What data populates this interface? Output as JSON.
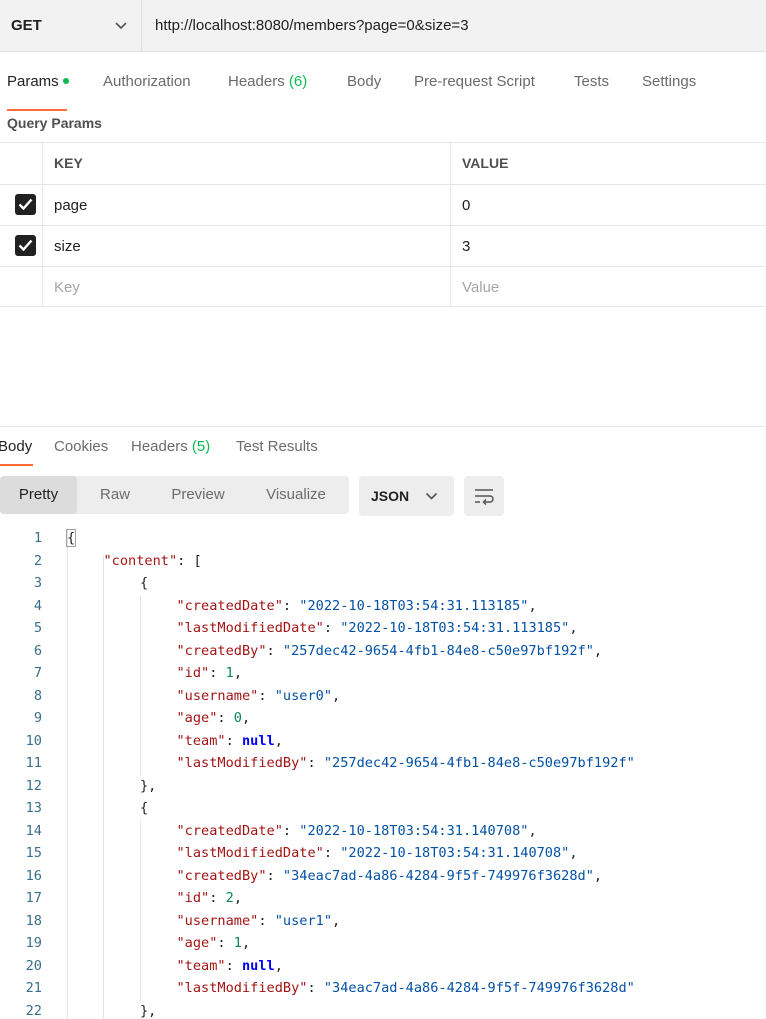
{
  "request": {
    "method": "GET",
    "url": "http://localhost:8080/members?page=0&size=3"
  },
  "request_tabs": [
    {
      "label": "Params",
      "count": null,
      "active": true
    },
    {
      "label": "Authorization",
      "count": null
    },
    {
      "label": "Headers",
      "count": "(6)"
    },
    {
      "label": "Body",
      "count": null
    },
    {
      "label": "Pre-request Script",
      "count": null
    },
    {
      "label": "Tests",
      "count": null
    },
    {
      "label": "Settings",
      "count": null
    }
  ],
  "query_params": {
    "title": "Query Params",
    "header_key": "KEY",
    "header_value": "VALUE",
    "rows": [
      {
        "key": "page",
        "value": "0",
        "checked": true
      },
      {
        "key": "size",
        "value": "3",
        "checked": true
      }
    ],
    "placeholder_key": "Key",
    "placeholder_value": "Value"
  },
  "response_tabs": [
    {
      "label": "Body",
      "count": null,
      "active": true
    },
    {
      "label": "Cookies",
      "count": null
    },
    {
      "label": "Headers",
      "count": "(5)"
    },
    {
      "label": "Test Results",
      "count": null
    }
  ],
  "view_modes": [
    "Pretty",
    "Raw",
    "Preview",
    "Visualize"
  ],
  "active_view": "Pretty",
  "format": "JSON",
  "code_lines": [
    {
      "n": "1",
      "indent": 0,
      "tokens": [
        [
          "p",
          "{"
        ]
      ],
      "hl": true
    },
    {
      "n": "2",
      "indent": 1,
      "tokens": [
        [
          "k",
          "\"content\""
        ],
        [
          "p",
          ": ["
        ]
      ]
    },
    {
      "n": "3",
      "indent": 2,
      "tokens": [
        [
          "p",
          "{"
        ]
      ]
    },
    {
      "n": "4",
      "indent": 3,
      "tokens": [
        [
          "k",
          "\"createdDate\""
        ],
        [
          "p",
          ": "
        ],
        [
          "s",
          "\"2022-10-18T03:54:31.113185\""
        ],
        [
          "p",
          ","
        ]
      ]
    },
    {
      "n": "5",
      "indent": 3,
      "tokens": [
        [
          "k",
          "\"lastModifiedDate\""
        ],
        [
          "p",
          ": "
        ],
        [
          "s",
          "\"2022-10-18T03:54:31.113185\""
        ],
        [
          "p",
          ","
        ]
      ]
    },
    {
      "n": "6",
      "indent": 3,
      "tokens": [
        [
          "k",
          "\"createdBy\""
        ],
        [
          "p",
          ": "
        ],
        [
          "s",
          "\"257dec42-9654-4fb1-84e8-c50e97bf192f\""
        ],
        [
          "p",
          ","
        ]
      ]
    },
    {
      "n": "7",
      "indent": 3,
      "tokens": [
        [
          "k",
          "\"id\""
        ],
        [
          "p",
          ": "
        ],
        [
          "n",
          "1"
        ],
        [
          "p",
          ","
        ]
      ]
    },
    {
      "n": "8",
      "indent": 3,
      "tokens": [
        [
          "k",
          "\"username\""
        ],
        [
          "p",
          ": "
        ],
        [
          "s",
          "\"user0\""
        ],
        [
          "p",
          ","
        ]
      ]
    },
    {
      "n": "9",
      "indent": 3,
      "tokens": [
        [
          "k",
          "\"age\""
        ],
        [
          "p",
          ": "
        ],
        [
          "n",
          "0"
        ],
        [
          "p",
          ","
        ]
      ]
    },
    {
      "n": "10",
      "indent": 3,
      "tokens": [
        [
          "k",
          "\"team\""
        ],
        [
          "p",
          ": "
        ],
        [
          "b",
          "null"
        ],
        [
          "p",
          ","
        ]
      ]
    },
    {
      "n": "11",
      "indent": 3,
      "tokens": [
        [
          "k",
          "\"lastModifiedBy\""
        ],
        [
          "p",
          ": "
        ],
        [
          "s",
          "\"257dec42-9654-4fb1-84e8-c50e97bf192f\""
        ]
      ]
    },
    {
      "n": "12",
      "indent": 2,
      "tokens": [
        [
          "p",
          "},"
        ]
      ]
    },
    {
      "n": "13",
      "indent": 2,
      "tokens": [
        [
          "p",
          "{"
        ]
      ]
    },
    {
      "n": "14",
      "indent": 3,
      "tokens": [
        [
          "k",
          "\"createdDate\""
        ],
        [
          "p",
          ": "
        ],
        [
          "s",
          "\"2022-10-18T03:54:31.140708\""
        ],
        [
          "p",
          ","
        ]
      ]
    },
    {
      "n": "15",
      "indent": 3,
      "tokens": [
        [
          "k",
          "\"lastModifiedDate\""
        ],
        [
          "p",
          ": "
        ],
        [
          "s",
          "\"2022-10-18T03:54:31.140708\""
        ],
        [
          "p",
          ","
        ]
      ]
    },
    {
      "n": "16",
      "indent": 3,
      "tokens": [
        [
          "k",
          "\"createdBy\""
        ],
        [
          "p",
          ": "
        ],
        [
          "s",
          "\"34eac7ad-4a86-4284-9f5f-749976f3628d\""
        ],
        [
          "p",
          ","
        ]
      ]
    },
    {
      "n": "17",
      "indent": 3,
      "tokens": [
        [
          "k",
          "\"id\""
        ],
        [
          "p",
          ": "
        ],
        [
          "n",
          "2"
        ],
        [
          "p",
          ","
        ]
      ]
    },
    {
      "n": "18",
      "indent": 3,
      "tokens": [
        [
          "k",
          "\"username\""
        ],
        [
          "p",
          ": "
        ],
        [
          "s",
          "\"user1\""
        ],
        [
          "p",
          ","
        ]
      ]
    },
    {
      "n": "19",
      "indent": 3,
      "tokens": [
        [
          "k",
          "\"age\""
        ],
        [
          "p",
          ": "
        ],
        [
          "n",
          "1"
        ],
        [
          "p",
          ","
        ]
      ]
    },
    {
      "n": "20",
      "indent": 3,
      "tokens": [
        [
          "k",
          "\"team\""
        ],
        [
          "p",
          ": "
        ],
        [
          "b",
          "null"
        ],
        [
          "p",
          ","
        ]
      ]
    },
    {
      "n": "21",
      "indent": 3,
      "tokens": [
        [
          "k",
          "\"lastModifiedBy\""
        ],
        [
          "p",
          ": "
        ],
        [
          "s",
          "\"34eac7ad-4a86-4284-9f5f-749976f3628d\""
        ]
      ]
    },
    {
      "n": "22",
      "indent": 2,
      "tokens": [
        [
          "p",
          "},"
        ]
      ]
    }
  ],
  "colors": {
    "accent": "#ff6c37",
    "count_green": "#0cbb52",
    "json_key": "#a31515",
    "json_string": "#0451a5",
    "json_number": "#098658",
    "json_null": "#0000ff"
  }
}
